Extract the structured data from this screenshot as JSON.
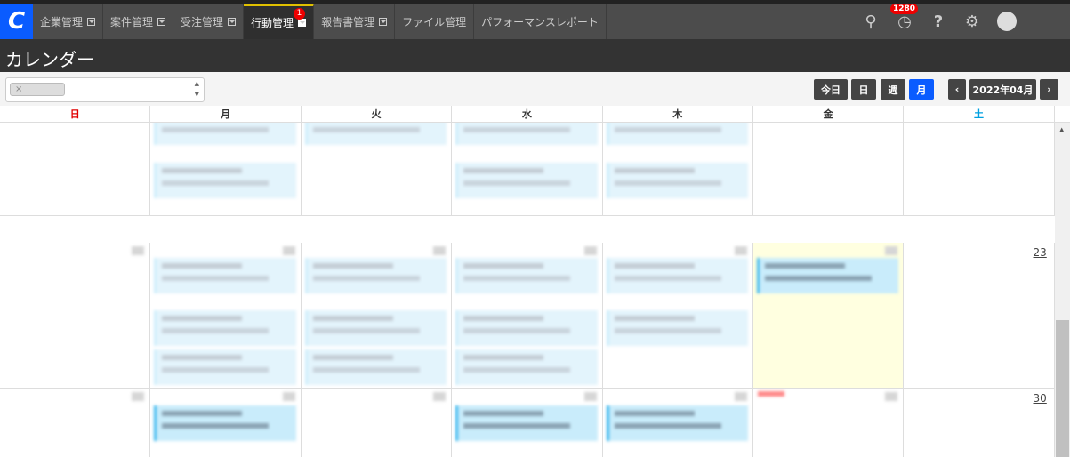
{
  "nav": {
    "tabs": [
      {
        "label": "企業管理",
        "dropdown": true
      },
      {
        "label": "案件管理",
        "dropdown": true
      },
      {
        "label": "受注管理",
        "dropdown": true
      },
      {
        "label": "行動管理",
        "dropdown": true,
        "active": true,
        "badge": "1"
      },
      {
        "label": "報告書管理",
        "dropdown": true
      },
      {
        "label": "ファイル管理"
      },
      {
        "label": "パフォーマンスレポート"
      }
    ],
    "notification_count": "1280"
  },
  "page_title": "カレンダー",
  "filter": {
    "chip_remove": "×"
  },
  "view_buttons": {
    "today": "今日",
    "day": "日",
    "week": "週",
    "month": "月",
    "prev": "‹",
    "current_month": "2022年04月",
    "next": "›"
  },
  "weekdays": [
    "日",
    "月",
    "火",
    "水",
    "木",
    "金",
    "土"
  ],
  "visible_dates": {
    "sat_week3": "23",
    "sat_week4": "30"
  },
  "colors": {
    "accent": "#0a5cff",
    "sunday": "#e00000",
    "saturday": "#00a0e0",
    "today_bg": "#ffffe0",
    "event_bg": "#e3f4fc"
  }
}
